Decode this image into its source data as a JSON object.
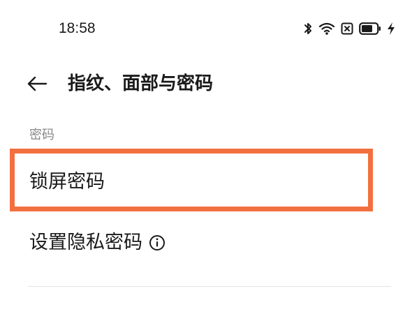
{
  "status_bar": {
    "time": "18:58",
    "icons": [
      "bluetooth-icon",
      "wifi-icon",
      "sim-disabled-icon",
      "battery-icon",
      "charging-icon"
    ],
    "battery_level": 0.75
  },
  "header": {
    "back_icon": "back-arrow-icon",
    "title": "指纹、面部与密码"
  },
  "section": {
    "label": "密码",
    "items": [
      {
        "label": "锁屏密码",
        "highlighted": true
      },
      {
        "label": "设置隐私密码",
        "icon": "info-icon"
      }
    ]
  },
  "colors": {
    "highlight": "#f2703f",
    "text_primary": "#1a1a1a",
    "text_secondary": "#888888",
    "divider": "#e3e3e3"
  }
}
